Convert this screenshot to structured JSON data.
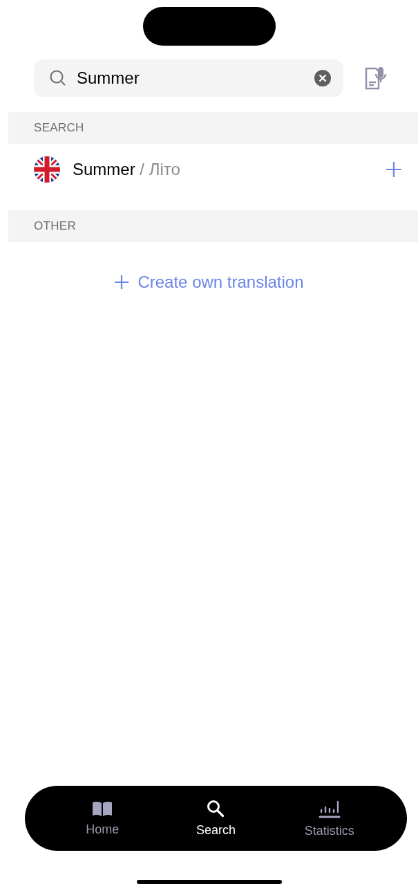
{
  "search": {
    "value": "Summer"
  },
  "sections": [
    {
      "title": "SEARCH",
      "results": [
        {
          "word": "Summer",
          "separator": "/",
          "translation": "Літо"
        }
      ]
    },
    {
      "title": "OTHER",
      "link": "Create own translation"
    }
  ],
  "tabs": [
    {
      "label": "Home",
      "kind": "book",
      "selected": false
    },
    {
      "label": "Search",
      "kind": "search",
      "selected": true
    },
    {
      "label": "Statistics",
      "kind": "chart",
      "selected": false
    }
  ]
}
